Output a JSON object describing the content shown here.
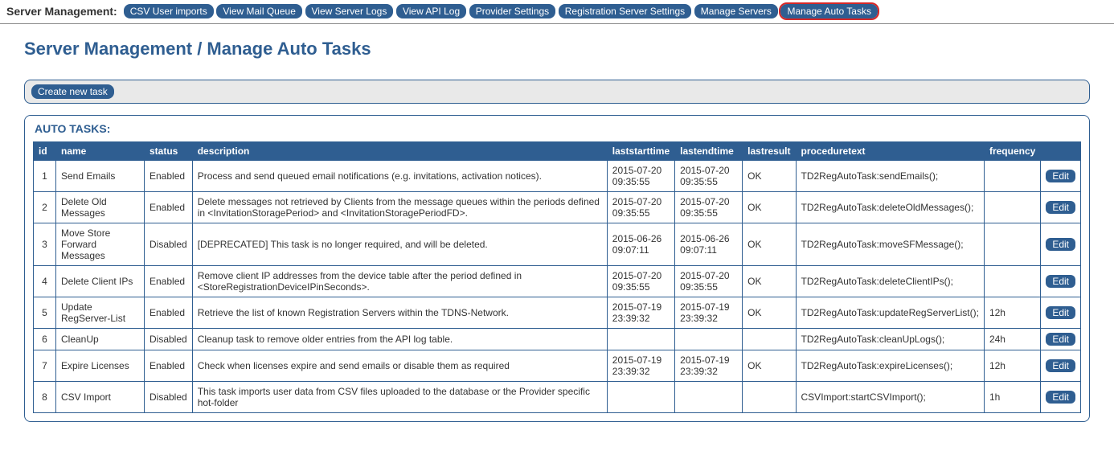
{
  "topbar": {
    "label": "Server Management:",
    "buttons": [
      {
        "label": "CSV User imports",
        "active": false
      },
      {
        "label": "View Mail Queue",
        "active": false
      },
      {
        "label": "View Server Logs",
        "active": false
      },
      {
        "label": "View API Log",
        "active": false
      },
      {
        "label": "Provider Settings",
        "active": false
      },
      {
        "label": "Registration Server Settings",
        "active": false
      },
      {
        "label": "Manage Servers",
        "active": false
      },
      {
        "label": "Manage Auto Tasks",
        "active": true
      }
    ]
  },
  "page": {
    "title": "Server Management / Manage Auto Tasks",
    "create_button": "Create new task",
    "panel_title": "AUTO TASKS:",
    "edit_label": "Edit"
  },
  "table": {
    "headers": {
      "id": "id",
      "name": "name",
      "status": "status",
      "description": "description",
      "laststarttime": "laststarttime",
      "lastendtime": "lastendtime",
      "lastresult": "lastresult",
      "proceduretext": "proceduretext",
      "frequency": "frequency"
    },
    "rows": [
      {
        "id": "1",
        "name": "Send Emails",
        "status": "Enabled",
        "description": "Process and send queued email notifications (e.g. invitations, activation notices).",
        "laststarttime": "2015-07-20 09:35:55",
        "lastendtime": "2015-07-20 09:35:55",
        "lastresult": "OK",
        "proceduretext": "TD2RegAutoTask:sendEmails();",
        "frequency": ""
      },
      {
        "id": "2",
        "name": "Delete Old Messages",
        "status": "Enabled",
        "description": "Delete messages not retrieved by Clients from the message queues within the periods defined in <InvitationStoragePeriod> and <InvitationStoragePeriodFD>.",
        "laststarttime": "2015-07-20 09:35:55",
        "lastendtime": "2015-07-20 09:35:55",
        "lastresult": "OK",
        "proceduretext": "TD2RegAutoTask:deleteOldMessages();",
        "frequency": ""
      },
      {
        "id": "3",
        "name": "Move Store Forward Messages",
        "status": "Disabled",
        "description": "[DEPRECATED] This task is no longer required, and will be deleted.",
        "laststarttime": "2015-06-26 09:07:11",
        "lastendtime": "2015-06-26 09:07:11",
        "lastresult": "OK",
        "proceduretext": "TD2RegAutoTask:moveSFMessage();",
        "frequency": ""
      },
      {
        "id": "4",
        "name": "Delete Client IPs",
        "status": "Enabled",
        "description": "Remove client IP addresses from the device table after the period defined in <StoreRegistrationDeviceIPinSeconds>.",
        "laststarttime": "2015-07-20 09:35:55",
        "lastendtime": "2015-07-20 09:35:55",
        "lastresult": "OK",
        "proceduretext": "TD2RegAutoTask:deleteClientIPs();",
        "frequency": ""
      },
      {
        "id": "5",
        "name": "Update RegServer-List",
        "status": "Enabled",
        "description": "Retrieve the list of known Registration Servers within the TDNS-Network.",
        "laststarttime": "2015-07-19 23:39:32",
        "lastendtime": "2015-07-19 23:39:32",
        "lastresult": "OK",
        "proceduretext": "TD2RegAutoTask:updateRegServerList();",
        "frequency": "12h"
      },
      {
        "id": "6",
        "name": "CleanUp",
        "status": "Disabled",
        "description": "Cleanup task to remove older entries from the API log table.",
        "laststarttime": "",
        "lastendtime": "",
        "lastresult": "",
        "proceduretext": "TD2RegAutoTask:cleanUpLogs();",
        "frequency": "24h"
      },
      {
        "id": "7",
        "name": "Expire Licenses",
        "status": "Enabled",
        "description": "Check when licenses expire and send emails or disable them as required",
        "laststarttime": "2015-07-19 23:39:32",
        "lastendtime": "2015-07-19 23:39:32",
        "lastresult": "OK",
        "proceduretext": "TD2RegAutoTask:expireLicenses();",
        "frequency": "12h"
      },
      {
        "id": "8",
        "name": "CSV Import",
        "status": "Disabled",
        "description": "This task imports user data from CSV files uploaded to the database or the Provider specific hot-folder",
        "laststarttime": "",
        "lastendtime": "",
        "lastresult": "",
        "proceduretext": "CSVImport:startCSVImport();",
        "frequency": "1h"
      }
    ]
  }
}
